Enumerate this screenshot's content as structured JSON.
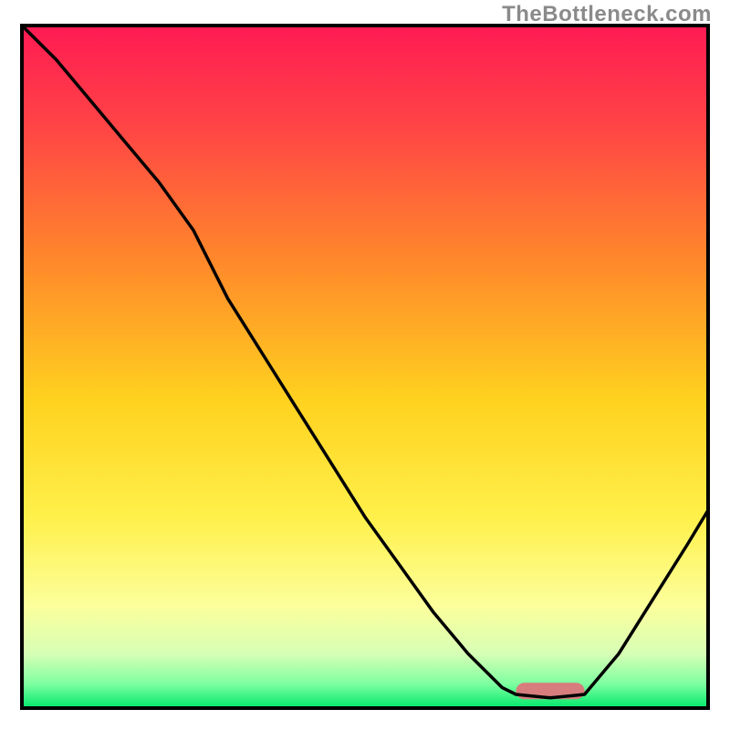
{
  "watermark": "TheBottleneck.com",
  "chart_data": {
    "type": "line",
    "title": "",
    "xlabel": "",
    "ylabel": "",
    "xlim": [
      0,
      100
    ],
    "ylim": [
      0,
      100
    ],
    "marker": {
      "x_start": 72,
      "x_end": 82,
      "y": 2.5
    },
    "series": [
      {
        "name": "bottleneck-curve",
        "x": [
          0,
          5,
          10,
          15,
          20,
          25,
          30,
          35,
          40,
          45,
          50,
          55,
          60,
          65,
          70,
          72,
          77,
          82,
          87,
          92,
          97,
          100
        ],
        "y": [
          100,
          95,
          89,
          83,
          77,
          70,
          60,
          52,
          44,
          36,
          28,
          21,
          14,
          8,
          3,
          2,
          1.5,
          2,
          8,
          16,
          24,
          29
        ]
      }
    ],
    "gradient_stops": [
      {
        "offset": 0,
        "color": "#ff1a54"
      },
      {
        "offset": 0.15,
        "color": "#ff4545"
      },
      {
        "offset": 0.35,
        "color": "#ff8a2a"
      },
      {
        "offset": 0.55,
        "color": "#ffd21f"
      },
      {
        "offset": 0.72,
        "color": "#fff04a"
      },
      {
        "offset": 0.85,
        "color": "#fcff9c"
      },
      {
        "offset": 0.92,
        "color": "#d7ffb5"
      },
      {
        "offset": 0.965,
        "color": "#7dffa0"
      },
      {
        "offset": 1.0,
        "color": "#00e86b"
      }
    ],
    "marker_color": "#d77d7d",
    "line_color": "#000000",
    "frame_color": "#000000"
  }
}
